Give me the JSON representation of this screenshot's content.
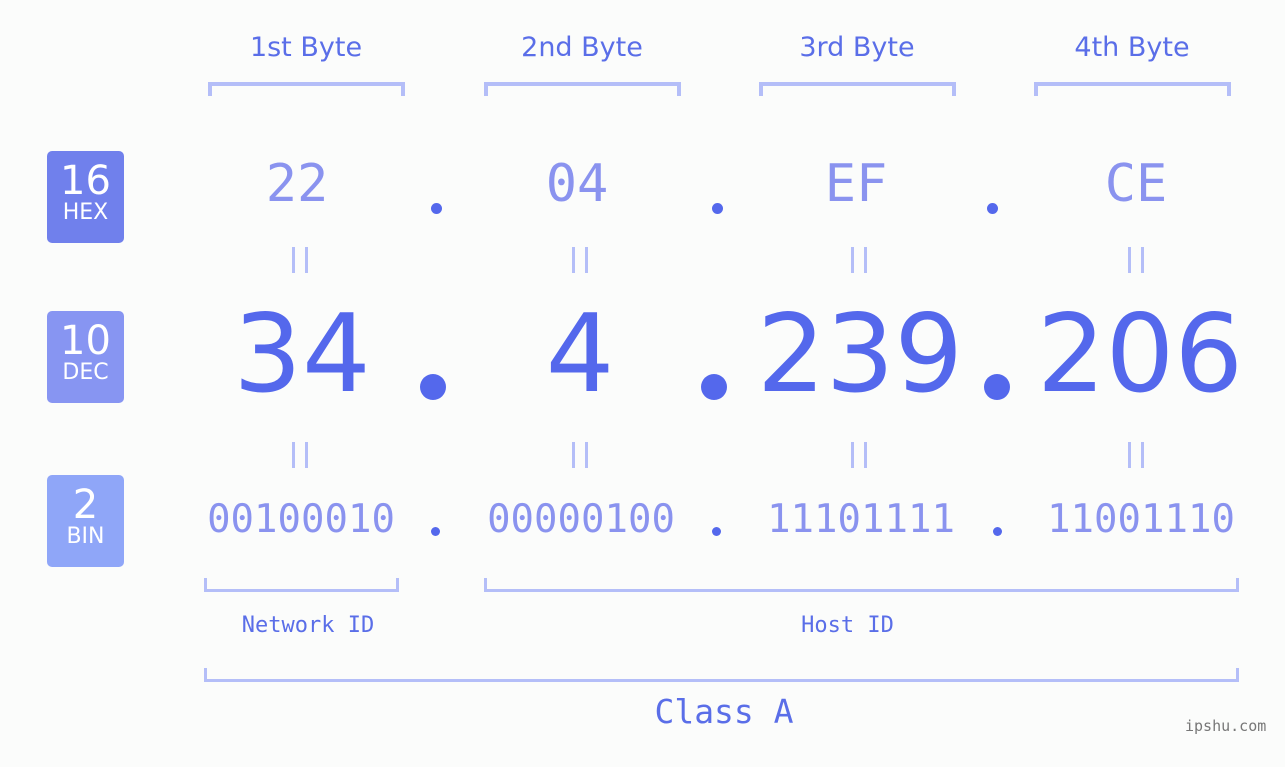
{
  "bytes": [
    {
      "label": "1st Byte",
      "hex": "22",
      "dec": "34",
      "bin": "00100010"
    },
    {
      "label": "2nd Byte",
      "hex": "04",
      "dec": "4",
      "bin": "00000100"
    },
    {
      "label": "3rd Byte",
      "hex": "EF",
      "dec": "239",
      "bin": "11101111"
    },
    {
      "label": "4th Byte",
      "hex": "CE",
      "dec": "206",
      "bin": "11001110"
    }
  ],
  "badges": {
    "hex": {
      "base": "16",
      "name": "HEX",
      "color": "#7080ec"
    },
    "dec": {
      "base": "10",
      "name": "DEC",
      "color": "#8795f2"
    },
    "bin": {
      "base": "2",
      "name": "BIN",
      "color": "#8fa6f8"
    }
  },
  "network_id_label": "Network ID",
  "host_id_label": "Host ID",
  "class_label": "Class A",
  "watermark": "ipshu.com",
  "colors": {
    "accent": "#5468ec",
    "light": "#8a93ef",
    "bracket": "#b4bef8"
  }
}
